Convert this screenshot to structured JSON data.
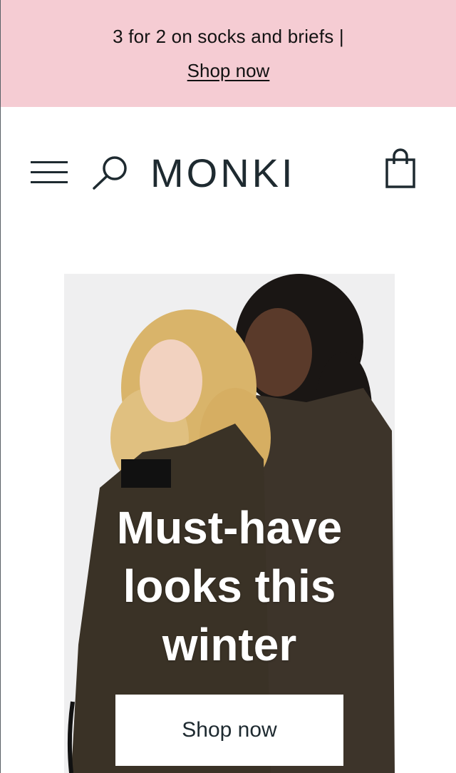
{
  "promo": {
    "text": "3 for 2 on socks and briefs |",
    "link_label": "Shop now"
  },
  "header": {
    "menu_icon": "hamburger-menu-icon",
    "search_icon": "search-icon",
    "logo_text": "MONKI",
    "bag_icon": "shopping-bag-icon"
  },
  "hero": {
    "title_lines": [
      "Must-have",
      "looks this",
      "winter"
    ],
    "cta_label": "Shop now"
  },
  "colors": {
    "promo_background": "#f5ccd3",
    "text_dark": "#1e2a30",
    "coat": "#3a3226",
    "hero_background": "#efeff0"
  }
}
